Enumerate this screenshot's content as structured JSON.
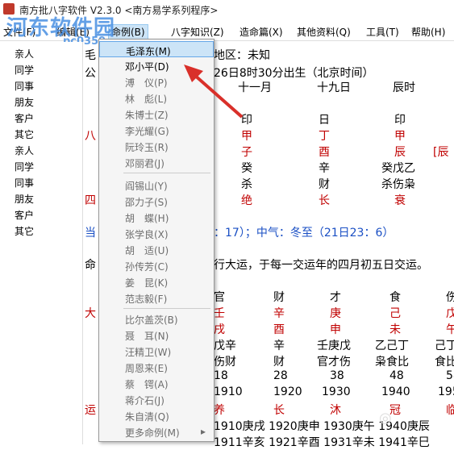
{
  "window": {
    "title": "南方批八字软件 V2.3.0   <南方易学系列程序>"
  },
  "watermark": {
    "text": "河东软件园",
    "url": "pc0359"
  },
  "menu": [
    {
      "label": "文件(F)"
    },
    {
      "label": "编辑(E)"
    },
    {
      "label": "命例(B)"
    },
    {
      "label": "八字知识(Z)"
    },
    {
      "label": "造命篇(X)"
    },
    {
      "label": "其他资料(Q)"
    },
    {
      "label": "工具(T)"
    },
    {
      "label": "帮助(H)"
    }
  ],
  "sidebar": [
    {
      "label": "亲人"
    },
    {
      "label": "同学"
    },
    {
      "label": "同事"
    },
    {
      "label": "朋友"
    },
    {
      "label": "客户"
    },
    {
      "label": "其它"
    },
    {
      "label": "亲人"
    },
    {
      "label": "同学"
    },
    {
      "label": "同事"
    },
    {
      "label": "朋友"
    },
    {
      "label": "客户"
    },
    {
      "label": "其它"
    }
  ],
  "dropdown": [
    {
      "label": "毛泽东(M)"
    },
    {
      "label": "邓小平(D)"
    },
    {
      "label": "溥　仪(P)"
    },
    {
      "label": "林　彪(L)"
    },
    {
      "label": "朱博士(Z)"
    },
    {
      "label": "李光耀(G)"
    },
    {
      "label": "阮玲玉(R)"
    },
    {
      "label": "邓丽君(J)"
    },
    {
      "label": "阎锡山(Y)"
    },
    {
      "label": "邵力子(S)"
    },
    {
      "label": "胡　蝶(H)"
    },
    {
      "label": "张学良(X)"
    },
    {
      "label": "胡　适(U)"
    },
    {
      "label": "孙传芳(C)"
    },
    {
      "label": "姜　昆(K)"
    },
    {
      "label": "范志毅(F)"
    },
    {
      "label": "比尔盖茨(B)"
    },
    {
      "label": "聂　耳(N)"
    },
    {
      "label": "汪精卫(W)"
    },
    {
      "label": "周恩来(E)"
    },
    {
      "label": "蔡　锷(A)"
    },
    {
      "label": "蒋介石(J)"
    },
    {
      "label": "朱自清(Q)"
    },
    {
      "label": "更多命例(M)"
    }
  ],
  "content": {
    "r1a": "毛",
    "r1b": "地区：未知",
    "r2a": "公",
    "r2b": "26日8时30分出生（北京时间）",
    "r3": [
      "十一月",
      "十九日",
      "辰时"
    ],
    "r4": [
      "印",
      "日",
      "印"
    ],
    "r5a": "八",
    "r5": [
      "甲",
      "丁",
      "甲"
    ],
    "r6": [
      "子",
      "酉",
      "辰",
      "[辰"
    ],
    "r7": [
      "癸",
      "辛",
      "癸戊乙"
    ],
    "r8": [
      "杀",
      "财",
      "杀伤枭"
    ],
    "r9a": "四",
    "r9": [
      "绝",
      "长",
      "衰"
    ],
    "r10a": "当",
    "r10": "：17）；中气：冬至（21日23：6）",
    "r11a": "命",
    "r11": "行大运，于每一交运年的四月初五日交运。",
    "r12": [
      "官",
      "财",
      "才",
      "食",
      "伤"
    ],
    "r13a": "大",
    "r13": [
      "壬",
      "辛",
      "庚",
      "己",
      "戊"
    ],
    "r14": [
      "戌",
      "酉",
      "申",
      "未",
      "午"
    ],
    "r15": [
      "戊辛",
      "辛",
      "壬庚戊",
      "乙己丁",
      "己丁"
    ],
    "r16": [
      "伤财",
      "财",
      "官才伤",
      "枭食比",
      "食比"
    ],
    "r17": [
      "18",
      "28",
      "38",
      "48",
      "58"
    ],
    "r18": [
      "1910",
      "1920",
      "1930",
      "1940",
      "1950"
    ],
    "r19a": "运",
    "r19": [
      "养",
      "长",
      "沐",
      "冠",
      "临"
    ],
    "r20": "1910庚戌  1920庚申  1930庚午  1940庚辰",
    "r21": "1911辛亥  1921辛酉  1931辛未  1941辛巳"
  }
}
